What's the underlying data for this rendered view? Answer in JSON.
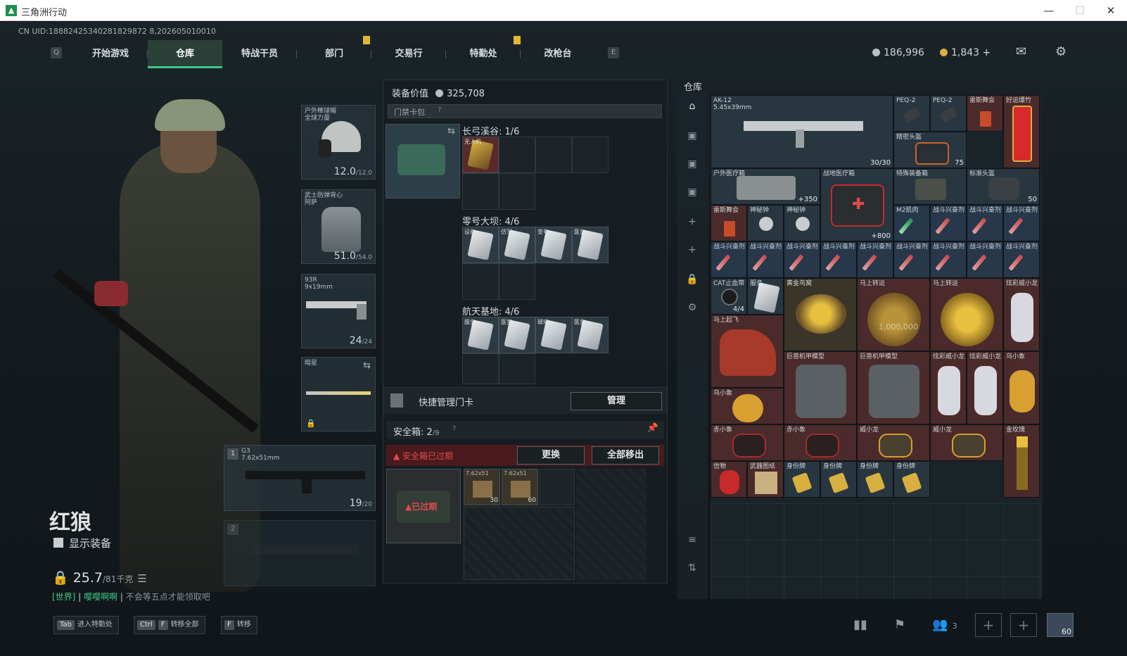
{
  "window": {
    "title": "三角洲行动",
    "minimize": "—",
    "maximize": "☐",
    "close": "✕"
  },
  "uid": "CN UID:18882425340281829872 8,202605010010",
  "nav": {
    "left_key": "Q",
    "right_key": "E",
    "tabs": [
      "开始游戏",
      "仓库",
      "特战干员",
      "部门",
      "交易行",
      "特勤处",
      "改枪台"
    ],
    "active": "仓库"
  },
  "currency": {
    "coins": "186,996",
    "premium": "1,843",
    "add": "+"
  },
  "character": {
    "name": "红狼",
    "show_gear_label": "显示装备",
    "weight": "25.7",
    "weight_max": "/81千克",
    "chat_channel": "[世界]",
    "chat_user": "嘤嘤啊啊",
    "chat_msg": "不会等五点才能领取吧"
  },
  "gear": {
    "helmet": {
      "name": "户外棒球帽\n全球力量",
      "durability": "12.0",
      "max": "/12.0"
    },
    "armor": {
      "name": "武士防弹背心\n阿萨",
      "durability": "51.0",
      "max": "/54.0"
    },
    "pistol": {
      "name": "93R\n9x19mm",
      "ammo": "24",
      "max": "/24"
    },
    "melee": {
      "name": "暗星"
    },
    "primary": {
      "idx": "1",
      "name": "G3\n7.62x51mm",
      "ammo": "19",
      "max": "/20"
    },
    "secondary": {
      "idx": "2"
    }
  },
  "center": {
    "value_label": "装备价值",
    "value": "325,708",
    "keycard_label": "门禁卡包",
    "help": "?",
    "maps": [
      {
        "name": "长弓溪谷: 1/6"
      },
      {
        "name": "零号大坝: 4/6"
      },
      {
        "name": "航天基地: 4/6"
      }
    ],
    "card_tags": [
      "无人机",
      "设备",
      "仿军",
      "变电",
      "医务",
      "服务",
      "医室",
      "玻璃",
      "医务"
    ],
    "quick_manage_label": "快捷管理门卡",
    "manage_button": "管理",
    "safebox_label": "安全箱:",
    "safebox_count": "2",
    "safebox_cap": "/9",
    "expired_warning": "安全箱已过期",
    "expired_tag": "已过期",
    "replace_button": "更换",
    "move_all_button": "全部移出",
    "ammo_tags": [
      "7.62x51",
      "7.62x51"
    ],
    "ammo_counts": [
      "30",
      "60"
    ]
  },
  "warehouse": {
    "title": "仓库",
    "items": {
      "ak12": {
        "name": "AK-12\n5.45x39mm",
        "q": "30/30"
      },
      "peq1": {
        "name": "PEQ-2"
      },
      "peq2": {
        "name": "PEQ-2"
      },
      "drink": {
        "name": "雷斯舞会"
      },
      "firecracker": {
        "name": "好运爆竹"
      },
      "bag": {
        "name": "精密头盔"
      },
      "bagq": "75",
      "medkit_outdoor": {
        "name": "户外医疗箱",
        "q": "+350"
      },
      "medkit_field": {
        "name": "战地医疗箱",
        "q": "+800"
      },
      "special_box": {
        "name": "特殊装备箱"
      },
      "std_helmet": {
        "name": "标准头盔",
        "q": "50"
      },
      "drink2": {
        "name": "雷斯舞会"
      },
      "bell1": {
        "name": "神秘钟"
      },
      "bell2": {
        "name": "神秘钟"
      },
      "stim_m2": {
        "name": "M2肌肉"
      },
      "stim_label": "战斗兴奋剂",
      "cat": {
        "name": "CAT止血带",
        "q": "4/4"
      },
      "service": {
        "name": "服务"
      },
      "gold_nest": {
        "name": "黄金鸟窝"
      },
      "horse_wheel1": {
        "name": "马上转运"
      },
      "horse_wheel2": {
        "name": "马上转运"
      },
      "colorful_dragon": {
        "name": "炫彩威小龙"
      },
      "horse_up": {
        "name": "马上起飞"
      },
      "mecha1": {
        "name": "巨兽机甲模型"
      },
      "mecha2": {
        "name": "巨兽机甲模型"
      },
      "dragon_b": {
        "name": "炫彩威小龙"
      },
      "dragon_c": {
        "name": "炫彩威小龙"
      },
      "elephant": {
        "name": "乌小象"
      },
      "elephant2": {
        "name": "乌小象"
      },
      "red_elephant1": {
        "name": "赤小象"
      },
      "red_elephant2": {
        "name": "赤小象"
      },
      "small_dragon1": {
        "name": "威小龙"
      },
      "small_dragon2": {
        "name": "威小龙"
      },
      "gold_rose": {
        "name": "金玫瑰"
      },
      "mask": {
        "name": "信物"
      },
      "scroll": {
        "name": "武器图纸"
      },
      "dogtag": {
        "name": "身份牌"
      },
      "wheel_price": "1,000,000"
    }
  },
  "bottom": {
    "tab_key": "Tab",
    "tab_label": "进入特勤处",
    "ctrl_key": "Ctrl",
    "f_key": "F",
    "transfer_all": "转移全部",
    "f_key2": "F",
    "transfer": "转移",
    "friends": "3",
    "avatar_level": "60"
  },
  "colors": {
    "accent": "#3ec98a",
    "gold": "#e8b62a",
    "warn": "#e04a4a"
  }
}
